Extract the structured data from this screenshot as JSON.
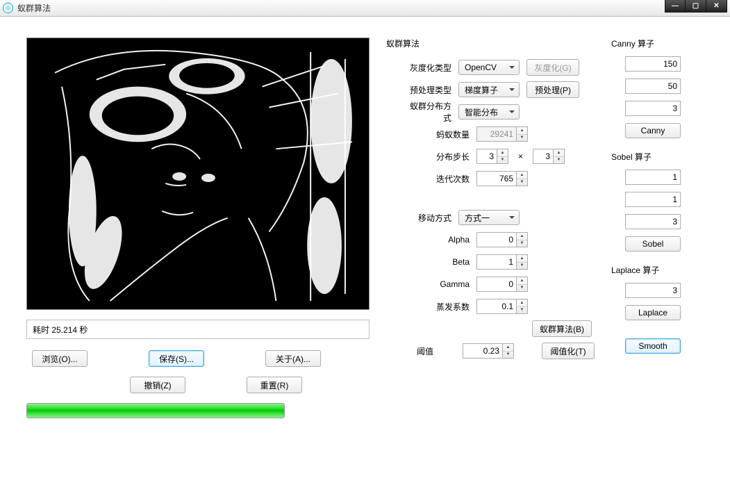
{
  "window": {
    "title": "蚁群算法"
  },
  "left": {
    "status": "耗时 25.214 秒",
    "browse": "浏览(O)...",
    "save": "保存(S)...",
    "about": "关于(A)...",
    "undo": "撤销(Z)",
    "reset": "重置(R)",
    "progress_pct": 100
  },
  "mid": {
    "group_title": "蚁群算法",
    "gray_type_lab": "灰度化类型",
    "gray_type_val": "OpenCV",
    "gray_btn": "灰度化(G)",
    "preproc_type_lab": "预处理类型",
    "preproc_type_val": "梯度算子",
    "preproc_btn": "预处理(P)",
    "dist_mode_lab": "蚁群分布方式",
    "dist_mode_val": "智能分布",
    "ant_count_lab": "蚂蚁数量",
    "ant_count_val": "29241",
    "step_lab": "分布步长",
    "step_a": "3",
    "step_b": "3",
    "iter_lab": "迭代次数",
    "iter_val": "765",
    "move_mode_lab": "移动方式",
    "move_mode_val": "方式一",
    "alpha_lab": "Alpha",
    "alpha_val": "0",
    "beta_lab": "Beta",
    "beta_val": "1",
    "gamma_lab": "Gamma",
    "gamma_val": "0",
    "evap_lab": "蒸发系数",
    "evap_val": "0.1",
    "run_btn": "蚁群算法(B)",
    "thresh_lab": "阈值",
    "thresh_val": "0.23",
    "thresh_btn": "阈值化(T)"
  },
  "right": {
    "canny_title": "Canny 算子",
    "canny_v1": "150",
    "canny_v2": "50",
    "canny_v3": "3",
    "canny_btn": "Canny",
    "sobel_title": "Sobel 算子",
    "sobel_v1": "1",
    "sobel_v2": "1",
    "sobel_v3": "3",
    "sobel_btn": "Sobel",
    "laplace_title": "Laplace 算子",
    "laplace_v1": "3",
    "laplace_btn": "Laplace",
    "smooth_btn": "Smooth"
  }
}
